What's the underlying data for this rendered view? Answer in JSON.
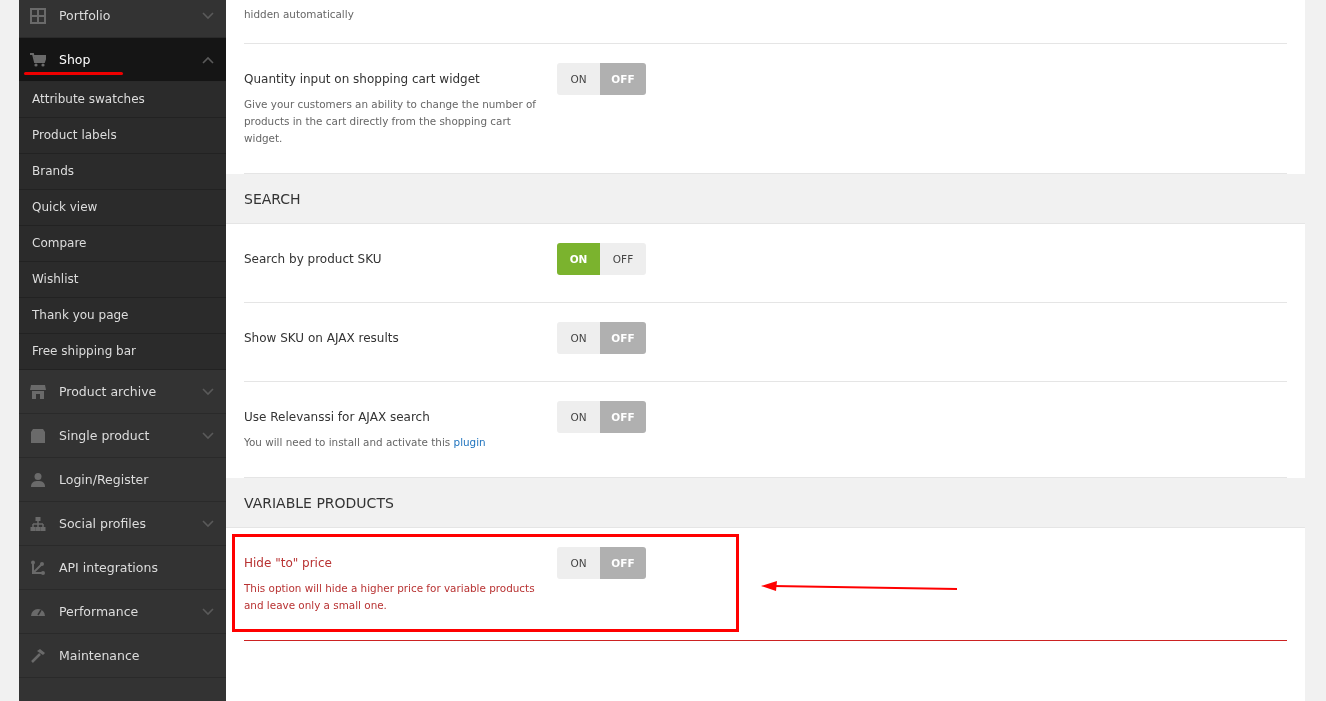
{
  "sidebar": {
    "items": [
      {
        "label": "Portfolio",
        "expanded": false,
        "underlined": false
      },
      {
        "label": "Shop",
        "expanded": true,
        "underlined": true,
        "children": [
          {
            "label": "Attribute swatches"
          },
          {
            "label": "Product labels"
          },
          {
            "label": "Brands"
          },
          {
            "label": "Quick view"
          },
          {
            "label": "Compare"
          },
          {
            "label": "Wishlist"
          },
          {
            "label": "Thank you page"
          },
          {
            "label": "Free shipping bar"
          }
        ]
      },
      {
        "label": "Product archive",
        "expanded": false,
        "underlined": false
      },
      {
        "label": "Single product",
        "expanded": false,
        "underlined": false
      },
      {
        "label": "Login/Register",
        "underlined": false
      },
      {
        "label": "Social profiles",
        "expanded": false,
        "underlined": false
      },
      {
        "label": "API integrations",
        "underlined": false
      },
      {
        "label": "Performance",
        "expanded": false,
        "underlined": false
      },
      {
        "label": "Maintenance",
        "underlined": false
      }
    ]
  },
  "content": [
    {
      "kind": "setting",
      "description": "hidden automatically",
      "highlighted": false
    },
    {
      "kind": "setting",
      "title": "Quantity input on shopping cart widget",
      "description": "Give your customers an ability to change the number of products in the cart directly from the shopping cart widget.",
      "on": false,
      "highlighted": false,
      "toggle": {
        "on_label": "ON",
        "off_label": "OFF"
      }
    },
    {
      "kind": "section",
      "title": "SEARCH"
    },
    {
      "kind": "setting",
      "title": "Search by product SKU",
      "on": true,
      "highlighted": false,
      "toggle": {
        "on_label": "ON",
        "off_label": "OFF"
      }
    },
    {
      "kind": "setting",
      "title": "Show SKU on AJAX results",
      "on": false,
      "highlighted": false,
      "toggle": {
        "on_label": "ON",
        "off_label": "OFF"
      }
    },
    {
      "kind": "setting",
      "title": "Use Relevanssi for AJAX search",
      "description": "You will need to install and activate this",
      "link": "plugin",
      "on": false,
      "highlighted": false,
      "toggle": {
        "on_label": "ON",
        "off_label": "OFF"
      }
    },
    {
      "kind": "section",
      "title": "VARIABLE PRODUCTS"
    },
    {
      "kind": "setting",
      "title": "Hide \"to\" price",
      "description": "This option will hide a higher price for variable products and leave only a small one.",
      "on": false,
      "highlighted": true,
      "toggle": {
        "on_label": "ON",
        "off_label": "OFF"
      }
    }
  ]
}
